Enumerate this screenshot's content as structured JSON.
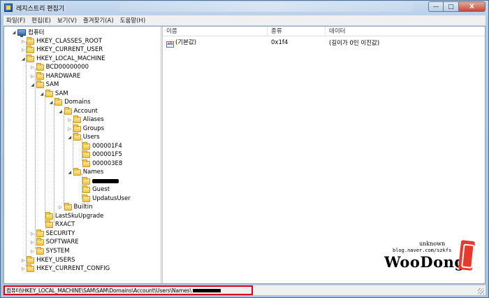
{
  "window": {
    "title": "레지스트리 편집기",
    "controls": {
      "minimize": "—",
      "maximize": "□",
      "close": "X"
    }
  },
  "menu": [
    "파일(F)",
    "편집(E)",
    "보기(V)",
    "즐겨찾기(A)",
    "도움말(H)"
  ],
  "tree": [
    {
      "label": "컴퓨터",
      "arrow": "◢",
      "icon": "computer-icon"
    },
    {
      "label": "HKEY_CLASSES_ROOT",
      "arrow": "▷",
      "icon": "folder-icon"
    },
    {
      "label": "HKEY_CURRENT_USER",
      "arrow": "▷",
      "icon": "folder-icon"
    },
    {
      "label": "HKEY_LOCAL_MACHINE",
      "arrow": "◢",
      "icon": "folder-icon"
    },
    {
      "label": "BCD00000000",
      "arrow": "▷",
      "icon": "folder-icon"
    },
    {
      "label": "HARDWARE",
      "arrow": "▷",
      "icon": "folder-icon"
    },
    {
      "label": "SAM",
      "arrow": "◢",
      "icon": "folder-icon"
    },
    {
      "label": "SAM",
      "arrow": "◢",
      "icon": "folder-icon"
    },
    {
      "label": "Domains",
      "arrow": "◢",
      "icon": "folder-icon"
    },
    {
      "label": "Account",
      "arrow": "◢",
      "icon": "folder-icon"
    },
    {
      "label": "Aliases",
      "arrow": "▷",
      "icon": "folder-icon"
    },
    {
      "label": "Groups",
      "arrow": "▷",
      "icon": "folder-icon"
    },
    {
      "label": "Users",
      "arrow": "◢",
      "icon": "folder-icon"
    },
    {
      "label": "000001F4",
      "arrow": "",
      "icon": "folder-icon"
    },
    {
      "label": "000001F5",
      "arrow": "",
      "icon": "folder-icon"
    },
    {
      "label": "000003E8",
      "arrow": "",
      "icon": "folder-icon"
    },
    {
      "label": "Names",
      "arrow": "◢",
      "icon": "folder-icon"
    },
    {
      "label": "",
      "arrow": "",
      "icon": "folder-icon",
      "redacted": true
    },
    {
      "label": "Guest",
      "arrow": "",
      "icon": "folder-icon"
    },
    {
      "label": "UpdatusUser",
      "arrow": "",
      "icon": "folder-icon"
    },
    {
      "label": "Builtin",
      "arrow": "▷",
      "icon": "folder-icon"
    },
    {
      "label": "LastSkuUpgrade",
      "arrow": "",
      "icon": "folder-icon"
    },
    {
      "label": "RXACT",
      "arrow": "",
      "icon": "folder-icon"
    },
    {
      "label": "SECURITY",
      "arrow": "▷",
      "icon": "folder-icon"
    },
    {
      "label": "SOFTWARE",
      "arrow": "▷",
      "icon": "folder-icon"
    },
    {
      "label": "SYSTEM",
      "arrow": "▷",
      "icon": "folder-icon"
    },
    {
      "label": "HKEY_USERS",
      "arrow": "▷",
      "icon": "folder-icon"
    },
    {
      "label": "HKEY_CURRENT_CONFIG",
      "arrow": "▷",
      "icon": "folder-icon"
    }
  ],
  "list": {
    "columns": {
      "name": "이름",
      "type": "종류",
      "data": "데이터"
    },
    "rows": [
      {
        "icon": "ab",
        "name": "(기본값)",
        "type": "0x1f4",
        "data": "(길이가 0인 이진값)"
      }
    ]
  },
  "watermark": {
    "unknown": "unknown",
    "url": "blog.naver.com/szkfs",
    "name": "WooDong"
  },
  "status": {
    "path": "컴퓨터\\HKEY_LOCAL_MACHINE\\SAM\\SAM\\Domains\\Account\\Users\\Names\\"
  }
}
